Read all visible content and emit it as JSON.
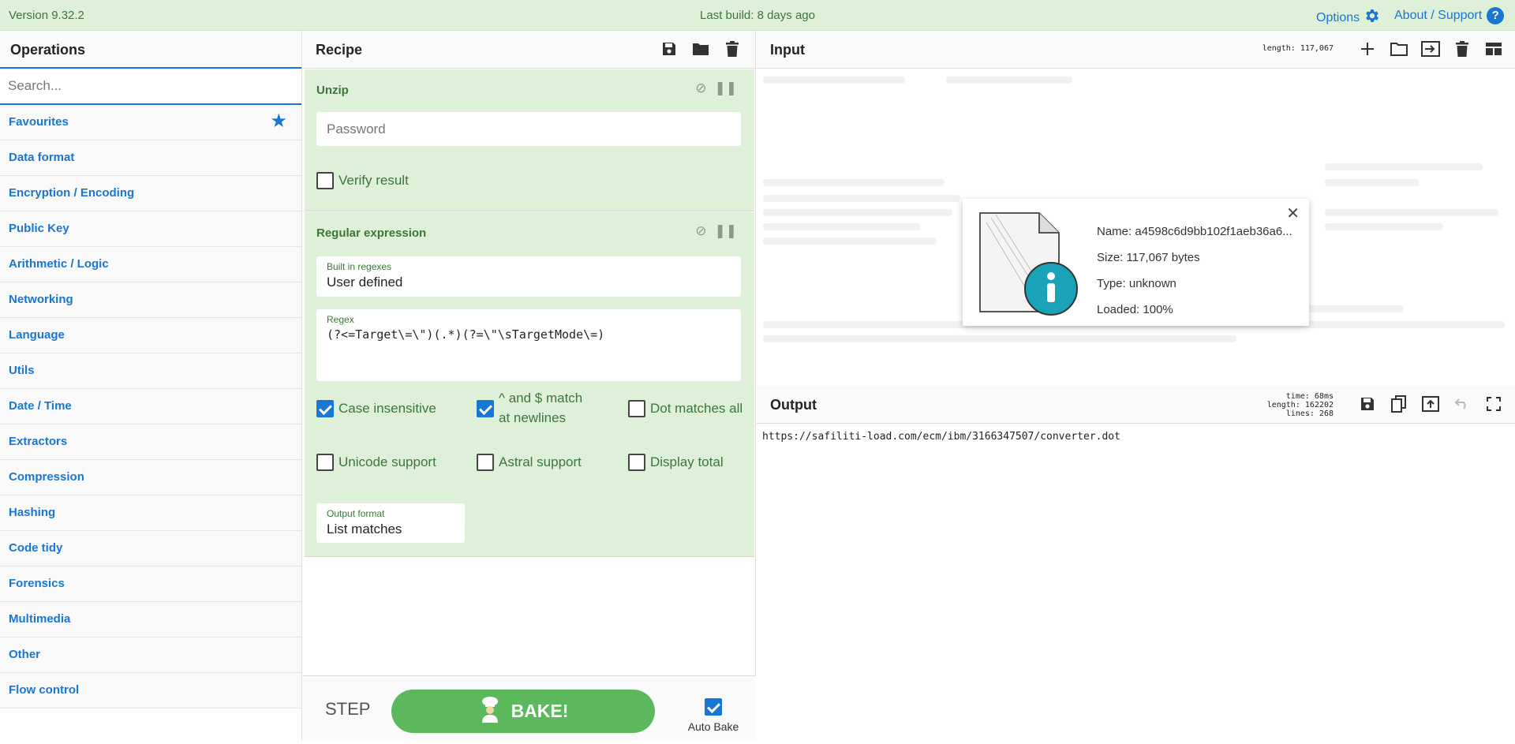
{
  "banner": {
    "version": "Version 9.32.2",
    "last_build": "Last build: 8 days ago",
    "options": "Options",
    "support": "About / Support"
  },
  "operations": {
    "title": "Operations",
    "search_placeholder": "Search...",
    "categories": [
      "Favourites",
      "Data format",
      "Encryption / Encoding",
      "Public Key",
      "Arithmetic / Logic",
      "Networking",
      "Language",
      "Utils",
      "Date / Time",
      "Extractors",
      "Compression",
      "Hashing",
      "Code tidy",
      "Forensics",
      "Multimedia",
      "Other",
      "Flow control"
    ]
  },
  "recipe": {
    "title": "Recipe",
    "unzip": {
      "title": "Unzip",
      "password_placeholder": "Password",
      "verify_label": "Verify result",
      "verify_checked": false
    },
    "regex": {
      "title": "Regular expression",
      "builtin_label": "Built in regexes",
      "builtin_value": "User defined",
      "regex_label": "Regex",
      "regex_value": "(?<=Target\\=\\\")(.*)(?=\\\"\\sTargetMode\\=)",
      "options": [
        {
          "label": "Case insensitive",
          "checked": true
        },
        {
          "label": "^ and $ match at newlines",
          "checked": true
        },
        {
          "label": "Dot matches all",
          "checked": false
        },
        {
          "label": "Unicode support",
          "checked": false
        },
        {
          "label": "Astral support",
          "checked": false
        },
        {
          "label": "Display total",
          "checked": false
        }
      ],
      "output_format_label": "Output format",
      "output_format_value": "List matches"
    },
    "step_label": "STEP",
    "bake_label": "BAKE!",
    "auto_bake_label": "Auto Bake",
    "auto_bake_checked": true
  },
  "input": {
    "title": "Input",
    "length_label": "length: 117,067",
    "file": {
      "name": "Name: a4598c6d9bb102f1aeb36a6...",
      "size": "Size: 117,067 bytes",
      "type": "Type: unknown",
      "loaded": "Loaded: 100%"
    }
  },
  "output": {
    "title": "Output",
    "time": "time:   68ms",
    "length": "length: 162202",
    "lines": "lines:    268",
    "text": "https://safiliti-load.com/ecm/ibm/3166347507/converter.dot"
  },
  "colors": {
    "accent": "#1976d2",
    "banner_bg": "#dff0d8",
    "op_bg": "#dff0d8",
    "op_text": "#3c763d",
    "bake": "#5cb85c",
    "info_icon": "#1aa3b8"
  }
}
